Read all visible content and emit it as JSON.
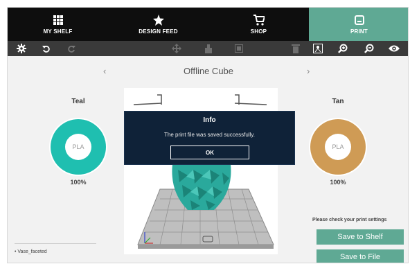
{
  "nav": {
    "items": [
      {
        "label": "MY SHELF",
        "icon": "grid-icon"
      },
      {
        "label": "DESIGN FEED",
        "icon": "star-icon"
      },
      {
        "label": "SHOP",
        "icon": "cart-icon"
      },
      {
        "label": "PRINT",
        "icon": "print-icon"
      }
    ],
    "active_color": "#5fa994"
  },
  "toolbar": {
    "icons": [
      "gear-icon",
      "undo-icon",
      "redo-icon",
      "move-icon",
      "rotate-icon",
      "scale-icon",
      "delete-icon",
      "view-icon",
      "zoom-in-icon",
      "zoom-out-icon",
      "eye-icon"
    ]
  },
  "model": {
    "title": "Offline Cube",
    "prev_arrow": "‹",
    "next_arrow": "›"
  },
  "materials": {
    "left": {
      "name": "Teal",
      "type": "PLA",
      "percent": "100%",
      "color": "#1fbfb0"
    },
    "right": {
      "name": "Tan",
      "type": "PLA",
      "percent": "100%",
      "color": "#cf9b55"
    }
  },
  "files": [
    "Vase_faceted"
  ],
  "dialog": {
    "title": "Info",
    "message": "The print file was saved successfully.",
    "ok_label": "OK"
  },
  "actions": {
    "hint": "Please check your print settings",
    "save_shelf": "Save to Shelf",
    "save_file": "Save to File"
  }
}
